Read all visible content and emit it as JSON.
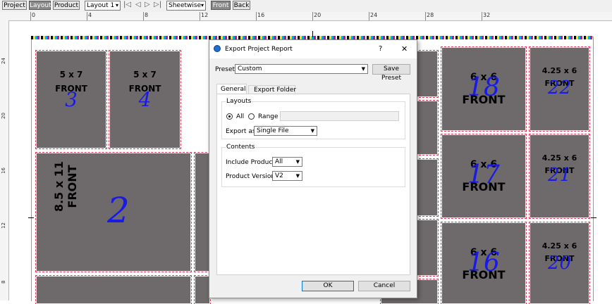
{
  "toolbar": {
    "project_label": "Project",
    "layout_label": "Layout",
    "product_label": "Product",
    "layout_select": "Layout 1",
    "mode_select": "Sheetwise",
    "front_label": "Front",
    "back_label": "Back"
  },
  "ruler": {
    "h_numbers": [
      "0",
      "4",
      "8",
      "12",
      "16",
      "20",
      "24",
      "28",
      "32"
    ],
    "v_numbers": [
      "24",
      "20",
      "16",
      "12",
      "8"
    ]
  },
  "panels": [
    {
      "size": "5 x 7",
      "side": "FRONT",
      "number": "3"
    },
    {
      "size": "5 x 7",
      "side": "FRONT",
      "number": "4"
    },
    {
      "size": "8.5 x 11",
      "side": "FRONT",
      "number": "2"
    },
    {
      "size": "6 x 6",
      "side": "FRONT",
      "number": "18"
    },
    {
      "size": "6 x 6",
      "side": "FRONT",
      "number": "17"
    },
    {
      "size": "6 x 6",
      "side": "FRONT",
      "number": "16"
    },
    {
      "size": "4.25 x 6",
      "side": "FRONT",
      "number": "22"
    },
    {
      "size": "4.25 x 6",
      "side": "FRONT",
      "number": "21"
    },
    {
      "size": "4.25 x 6",
      "side": "FRONT",
      "number": "20"
    }
  ],
  "dialog": {
    "title": "Export Project Report",
    "help": "?",
    "close": "✕",
    "preset_label": "Preset",
    "preset_value": "Custom",
    "save_preset": "Save Preset",
    "tabs": [
      "General",
      "Export Folder"
    ],
    "layouts_group": "Layouts",
    "all_label": "All",
    "range_label": "Range",
    "range_value": "",
    "export_as_label": "Export as",
    "export_as_value": "Single File",
    "contents_group": "Contents",
    "include_products_label": "Include Products",
    "include_products_value": "All",
    "product_version_label": "Product Version",
    "product_version_value": "V2",
    "ok": "OK",
    "cancel": "Cancel"
  }
}
